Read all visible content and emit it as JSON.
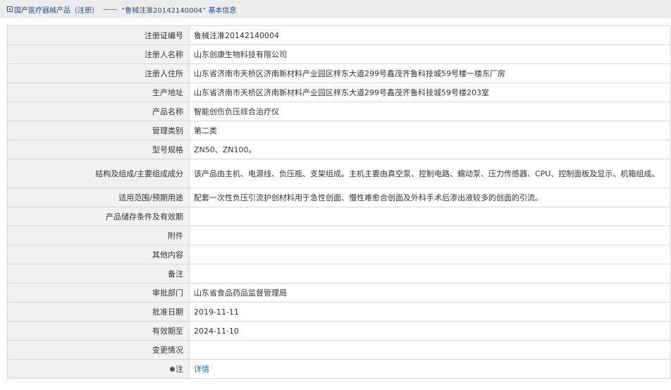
{
  "breadcrumb": {
    "root": "国产医疗器械产品（注册）",
    "separator": "——",
    "current": "“鲁械注准20142140004” 基本信息"
  },
  "rows": [
    {
      "label": "注册证编号",
      "value": "鲁械注准20142140004"
    },
    {
      "label": "注册人名称",
      "value": "山东创康生物科技有限公司"
    },
    {
      "label": "注册人住所",
      "value": "山东省济南市天桥区济南新材料产业园区梓东大道299号鑫茂齐鲁科技城59号楼一楼东厂房"
    },
    {
      "label": "生产地址",
      "value": "山东省济南市天桥区济南新材料产业园区梓东大道299号鑫茂齐鲁科技城59号楼203室"
    },
    {
      "label": "产品名称",
      "value": "智能创伤负压综合治疗仪"
    },
    {
      "label": "管理类别",
      "value": "第二类"
    },
    {
      "label": "型号规格",
      "value": "ZN50、ZN100。"
    },
    {
      "label": "结构及组成/主要组成成分",
      "value": "该产品由主机、电源线、负压瓶、支架组成。主机主要由真空泵、控制电路、蠕动泵、压力传感器、CPU、控制面板及显示、机箱组成。"
    },
    {
      "label": "适用范围/预期用途",
      "value": "配套一次性负压引流护创材料用于急性创面、慢性难愈合创面及外科手术后渗出液较多的创面的引流。"
    },
    {
      "label": "产品储存条件及有效期",
      "value": ""
    },
    {
      "label": "附件",
      "value": ""
    },
    {
      "label": "其他内容",
      "value": ""
    },
    {
      "label": "备注",
      "value": ""
    },
    {
      "label": "审批部门",
      "value": "山东省食品药品监督管理局"
    },
    {
      "label": "批准日期",
      "value": "2019-11-11"
    },
    {
      "label": "有效期至",
      "value": "2024-11-10"
    },
    {
      "label": "变更情况",
      "value": ""
    },
    {
      "label": "注",
      "value": "详情"
    }
  ],
  "colors": {
    "topbar_bg": "#ececec",
    "label_bg": "#f1f1f1",
    "border": "#d5d5d5",
    "link": "#1d6fb8",
    "breadcrumb_text": "#1d4f8b"
  }
}
